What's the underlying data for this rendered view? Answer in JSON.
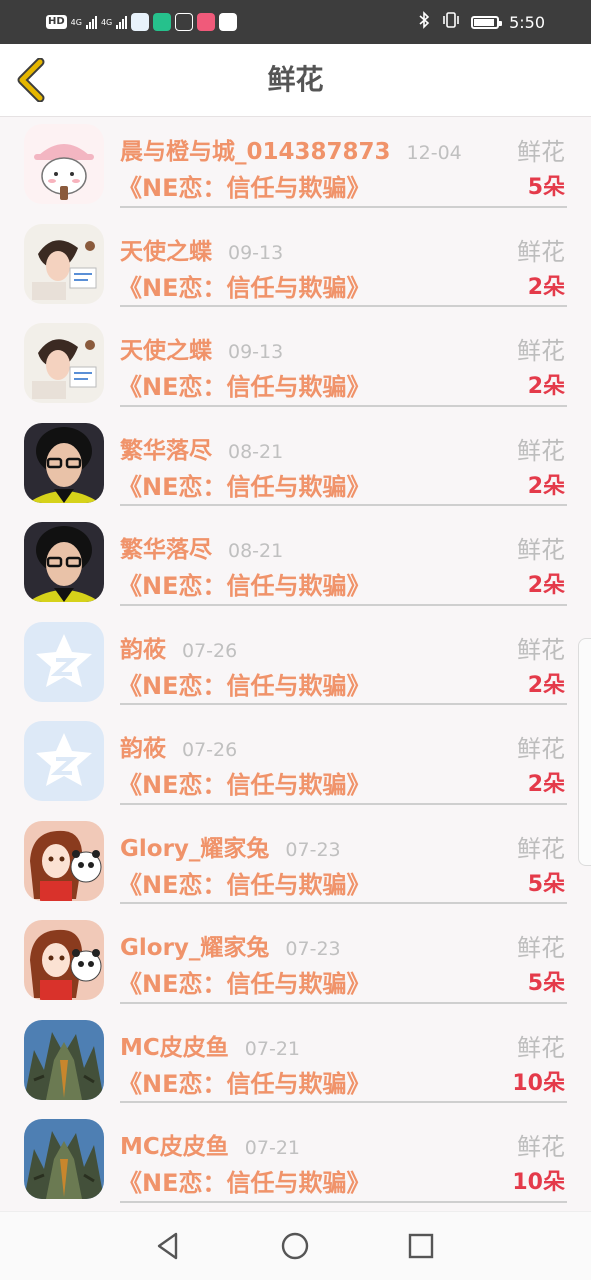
{
  "status_bar": {
    "badge": "HD",
    "network1": "4G",
    "network2": "4G",
    "time": "5:50",
    "battery_level": 0.9
  },
  "header": {
    "title": "鲜花",
    "back_icon": "chevron-left-icon"
  },
  "list": [
    {
      "name": "晨与橙与城_014387873",
      "date": "12-04",
      "gift_label": "鲜花",
      "book": "《NE恋：信任与欺骗》",
      "count": "5朵",
      "avatar": "cartoon-girl-hat"
    },
    {
      "name": "天使之蝶",
      "date": "09-13",
      "gift_label": "鲜花",
      "book": "《NE恋：信任与欺骗》",
      "count": "2朵",
      "avatar": "girl-photo"
    },
    {
      "name": "天使之蝶",
      "date": "09-13",
      "gift_label": "鲜花",
      "book": "《NE恋：信任与欺骗》",
      "count": "2朵",
      "avatar": "girl-photo"
    },
    {
      "name": "繁华落尽",
      "date": "08-21",
      "gift_label": "鲜花",
      "book": "《NE恋：信任与欺骗》",
      "count": "2朵",
      "avatar": "glasses-girl"
    },
    {
      "name": "繁华落尽",
      "date": "08-21",
      "gift_label": "鲜花",
      "book": "《NE恋：信任与欺骗》",
      "count": "2朵",
      "avatar": "glasses-girl"
    },
    {
      "name": "韵莜",
      "date": "07-26",
      "gift_label": "鲜花",
      "book": "《NE恋：信任与欺骗》",
      "count": "2朵",
      "avatar": "default-qq"
    },
    {
      "name": "韵莜",
      "date": "07-26",
      "gift_label": "鲜花",
      "book": "《NE恋：信任与欺骗》",
      "count": "2朵",
      "avatar": "default-qq"
    },
    {
      "name": "Glory_耀家兔",
      "date": "07-23",
      "gift_label": "鲜花",
      "book": "《NE恋：信任与欺骗》",
      "count": "5朵",
      "avatar": "anime-girl-panda"
    },
    {
      "name": "Glory_耀家兔",
      "date": "07-23",
      "gift_label": "鲜花",
      "book": "《NE恋：信任与欺骗》",
      "count": "5朵",
      "avatar": "anime-girl-panda"
    },
    {
      "name": "MC皮皮鱼",
      "date": "07-21",
      "gift_label": "鲜花",
      "book": "《NE恋：信任与欺骗》",
      "count": "10朵",
      "avatar": "monster-photo"
    },
    {
      "name": "MC皮皮鱼",
      "date": "07-21",
      "gift_label": "鲜花",
      "book": "《NE恋：信任与欺骗》",
      "count": "10朵",
      "avatar": "monster-photo"
    }
  ],
  "navbar": {
    "back_icon": "triangle-back-icon",
    "home_icon": "circle-home-icon",
    "recents_icon": "square-recents-icon"
  },
  "colors": {
    "accent_name": "#f0936a",
    "count": "#e43a4a",
    "muted": "#bdbdbd",
    "back_chevron": "#e5b600"
  }
}
